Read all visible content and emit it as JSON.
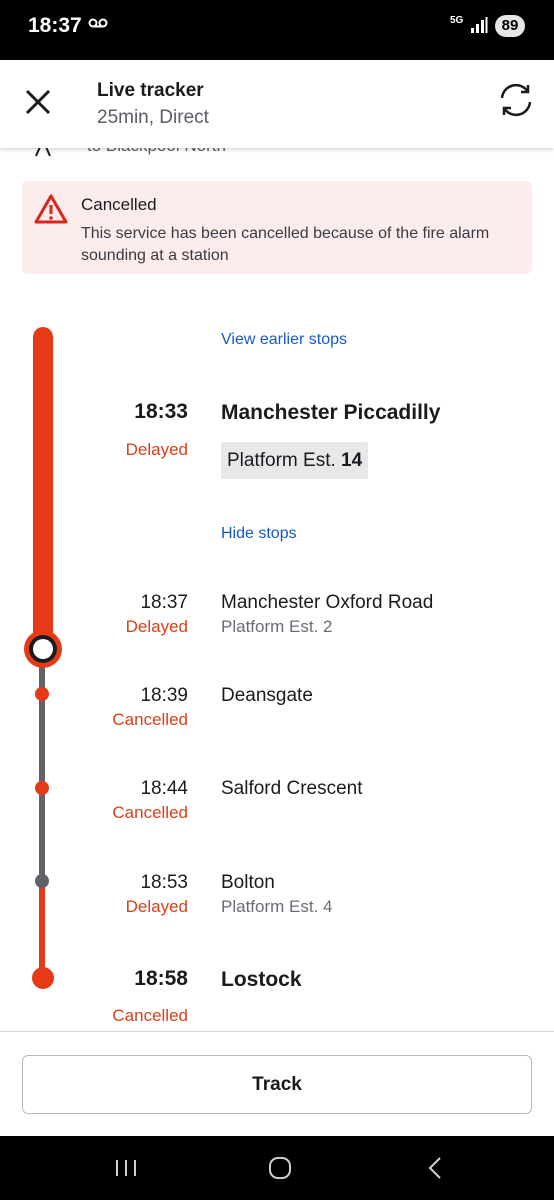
{
  "status_bar": {
    "time": "18:37",
    "network_label": "5G",
    "battery": "89"
  },
  "header": {
    "title": "Live tracker",
    "subtitle": "25min, Direct"
  },
  "peek_row": {
    "text": "to Blackpool North"
  },
  "alert": {
    "title": "Cancelled",
    "message": "This service has been cancelled because of the fire alarm sounding at a station"
  },
  "journey": {
    "view_earlier_label": "View earlier stops",
    "hide_stops_label": "Hide stops",
    "origin": {
      "time": "18:33",
      "status": "Delayed",
      "station": "Manchester Piccadilly",
      "platform_prefix": "Platform Est.",
      "platform_number": "14"
    },
    "stops": [
      {
        "time": "18:37",
        "status": "Delayed",
        "station": "Manchester Oxford Road",
        "platform": "Platform Est. 2"
      },
      {
        "time": "18:39",
        "status": "Cancelled",
        "station": "Deansgate",
        "platform": ""
      },
      {
        "time": "18:44",
        "status": "Cancelled",
        "station": "Salford Crescent",
        "platform": ""
      },
      {
        "time": "18:53",
        "status": "Delayed",
        "station": "Bolton",
        "platform": "Platform Est. 4"
      }
    ],
    "destination": {
      "time": "18:58",
      "status": "Cancelled",
      "station": "Lostock"
    }
  },
  "actions": {
    "track_label": "Track"
  },
  "colors": {
    "accent_red": "#e63a17",
    "status_red": "#d8401b",
    "link_blue": "#1859c9",
    "alert_bg": "#fdecec"
  },
  "icons": [
    "close-icon",
    "refresh-icon",
    "warning-icon",
    "voicemail-icon",
    "signal-icon",
    "recents-icon",
    "home-icon",
    "back-icon"
  ]
}
